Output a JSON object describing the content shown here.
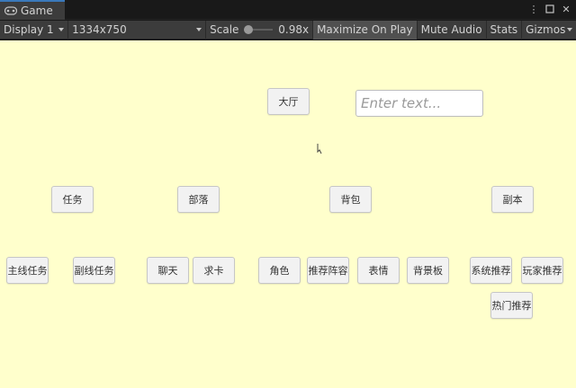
{
  "window": {
    "tab_label": "Game",
    "tab_icon": "gamepad-icon",
    "controls": [
      "more-icon",
      "maximize-icon",
      "close-icon"
    ],
    "accent_color": "#3a79bb"
  },
  "toolbar": {
    "display": "Display 1",
    "resolution": "1334x750",
    "scale_label": "Scale",
    "scale_value": "0.98x",
    "maximize_on_play": "Maximize On Play",
    "mute_audio": "Mute Audio",
    "stats": "Stats",
    "gizmos": "Gizmos"
  },
  "game": {
    "background": "#ffffcc",
    "lobby_button": "大厅",
    "text_input_placeholder": "Enter text...",
    "categories": {
      "task": "任务",
      "tribe": "部落",
      "backpack": "背包",
      "dungeon": "副本"
    },
    "subs": {
      "main_quest": "主线任务",
      "side_quest": "副线任务",
      "chat": "聊天",
      "seek_card": "求卡",
      "character": "角色",
      "recommend_lineup": "推荐阵容",
      "emote": "表情",
      "background_board": "背景板",
      "system_recommend": "系统推荐",
      "player_recommend": "玩家推荐",
      "hot_recommend": "热门推荐"
    }
  }
}
